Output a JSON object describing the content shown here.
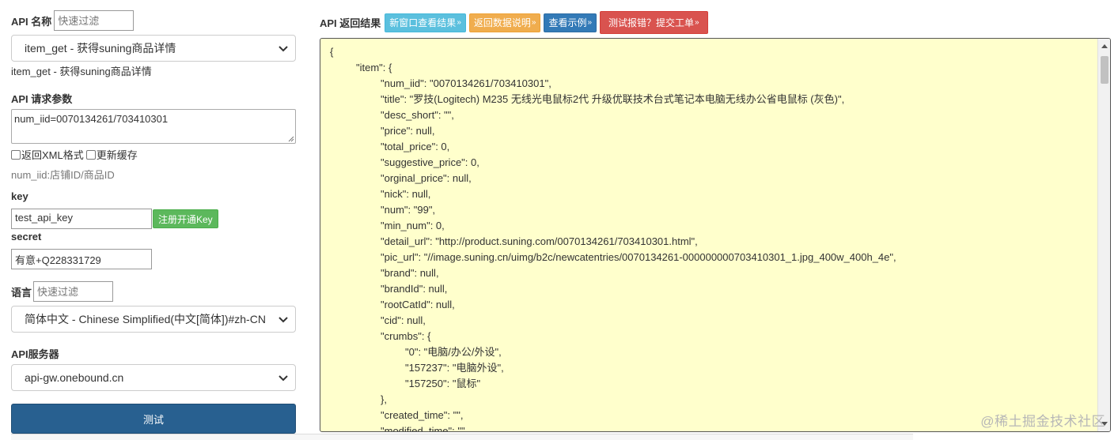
{
  "api_name": {
    "label": "API 名称",
    "filter_placeholder": "快速过滤",
    "selected": "item_get - 获得suning商品详情",
    "description": "item_get - 获得suning商品详情"
  },
  "request_params": {
    "label": "API 请求参数",
    "value": "num_iid=0070134261/703410301",
    "xml_label": "返回XML格式",
    "cache_label": "更新缓存",
    "hint": "num_iid:店铺ID/商品ID"
  },
  "key": {
    "label": "key",
    "value": "test_api_key",
    "register_button": "注册开通Key"
  },
  "secret": {
    "label": "secret",
    "value": "有意+Q228331729"
  },
  "language": {
    "label": "语言",
    "filter_placeholder": "快速过滤",
    "selected": "简体中文 - Chinese Simplified(中文[简体])#zh-CN"
  },
  "server": {
    "label": "API服务器",
    "selected": "api-gw.onebound.cn"
  },
  "test_button": "测试",
  "result_header": {
    "title": "API 返回结果",
    "new_window": "新窗口查看结果",
    "data_doc": "返回数据说明",
    "example": "查看示例",
    "report": "测试报错？提交工单",
    "arrow": "»"
  },
  "result_lines": [
    {
      "indent": 0,
      "text": "{"
    },
    {
      "indent": 1,
      "text": "\"item\": {"
    },
    {
      "indent": 2,
      "text": "\"num_iid\": \"0070134261/703410301\","
    },
    {
      "indent": 2,
      "text": "\"title\": \"罗技(Logitech) M235 无线光电鼠标2代 升级优联技术台式笔记本电脑无线办公省电鼠标 (灰色)\","
    },
    {
      "indent": 2,
      "text": "\"desc_short\": \"\","
    },
    {
      "indent": 2,
      "text": "\"price\": null,"
    },
    {
      "indent": 2,
      "text": "\"total_price\": 0,"
    },
    {
      "indent": 2,
      "text": "\"suggestive_price\": 0,"
    },
    {
      "indent": 2,
      "text": "\"orginal_price\": null,"
    },
    {
      "indent": 2,
      "text": "\"nick\": null,"
    },
    {
      "indent": 2,
      "text": "\"num\": \"99\","
    },
    {
      "indent": 2,
      "text": "\"min_num\": 0,"
    },
    {
      "indent": 2,
      "text": "\"detail_url\": \"http://product.suning.com/0070134261/703410301.html\","
    },
    {
      "indent": 2,
      "text": "\"pic_url\": \"//image.suning.cn/uimg/b2c/newcatentries/0070134261-000000000703410301_1.jpg_400w_400h_4e\","
    },
    {
      "indent": 2,
      "text": "\"brand\": null,"
    },
    {
      "indent": 2,
      "text": "\"brandId\": null,"
    },
    {
      "indent": 2,
      "text": "\"rootCatId\": null,"
    },
    {
      "indent": 2,
      "text": "\"cid\": null,"
    },
    {
      "indent": 2,
      "text": "\"crumbs\": {"
    },
    {
      "indent": 3,
      "text": "\"0\": \"电脑/办公/外设\","
    },
    {
      "indent": 3,
      "text": "\"157237\": \"电脑外设\","
    },
    {
      "indent": 3,
      "text": "\"157250\": \"鼠标\""
    },
    {
      "indent": 2,
      "text": "},"
    },
    {
      "indent": 2,
      "text": "\"created_time\": \"\","
    },
    {
      "indent": 2,
      "text": "\"modified_time\": \"\","
    }
  ],
  "watermark": "@稀土掘金技术社区",
  "colors": {
    "result_bg": "#ffffcc",
    "primary": "#286090",
    "success": "#5cb85c",
    "info": "#5bc0de",
    "warning": "#f0ad4e",
    "danger": "#d9534f"
  }
}
